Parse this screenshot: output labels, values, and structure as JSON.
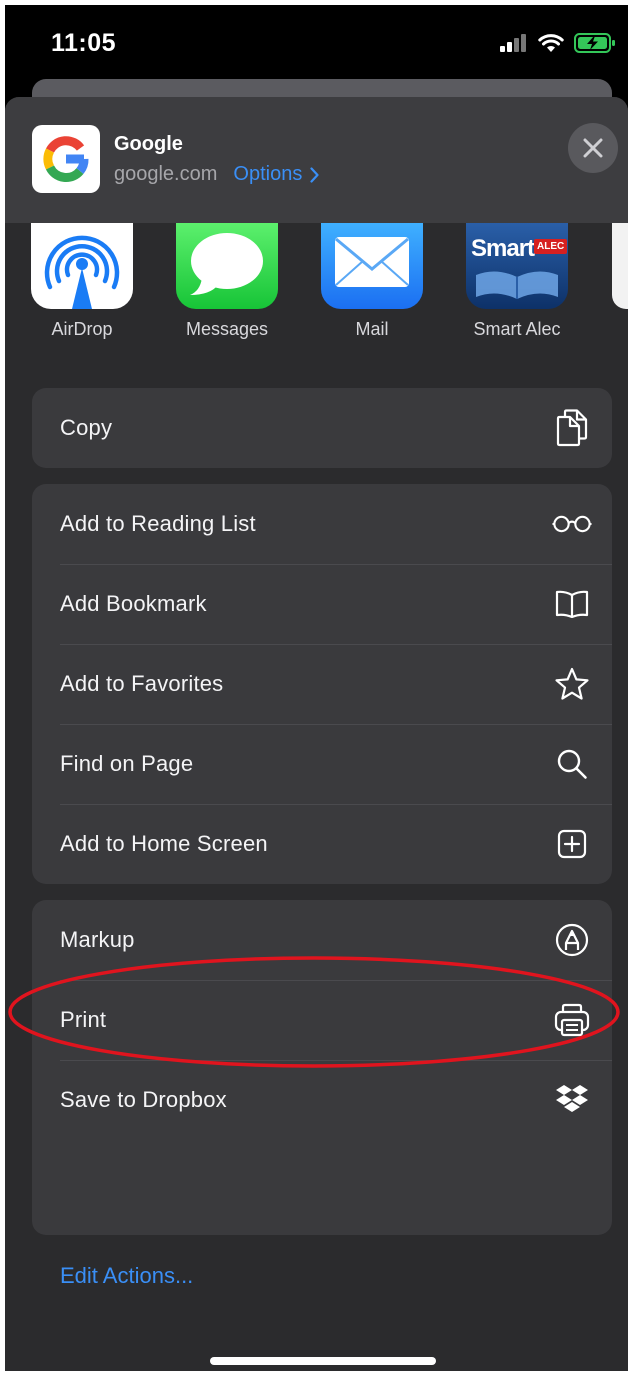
{
  "status_bar": {
    "time": "11:05",
    "icons": [
      "signal-icon",
      "wifi-icon",
      "battery-charging-icon"
    ]
  },
  "header": {
    "title": "Google",
    "domain": "google.com",
    "options_label": "Options",
    "options_chevron": "›"
  },
  "apps": [
    {
      "label": "AirDrop",
      "icon": "airdrop-icon"
    },
    {
      "label": "Messages",
      "icon": "messages-icon"
    },
    {
      "label": "Mail",
      "icon": "mail-icon"
    },
    {
      "label": "Smart Alec",
      "icon": "smart-alec-icon"
    }
  ],
  "smart_alec_logo": {
    "text": "Smart",
    "badge": "ALEC"
  },
  "groups": [
    [
      {
        "label": "Copy",
        "icon": "copy-icon"
      }
    ],
    [
      {
        "label": "Add to Reading List",
        "icon": "glasses-icon"
      },
      {
        "label": "Add Bookmark",
        "icon": "book-icon"
      },
      {
        "label": "Add to Favorites",
        "icon": "star-icon"
      },
      {
        "label": "Find on Page",
        "icon": "search-icon"
      },
      {
        "label": "Add to Home Screen",
        "icon": "plus-square-icon"
      }
    ],
    [
      {
        "label": "Markup",
        "icon": "markup-icon"
      },
      {
        "label": "Print",
        "icon": "printer-icon"
      },
      {
        "label": "Save to Dropbox",
        "icon": "dropbox-icon"
      }
    ]
  ],
  "edit_actions_label": "Edit Actions...",
  "colors": {
    "sheet": "#2b2b2d",
    "row": "#3a3a3d",
    "accent_blue": "#3a8ff6",
    "annotation_red": "#e0141e",
    "battery_green": "#34c759"
  }
}
